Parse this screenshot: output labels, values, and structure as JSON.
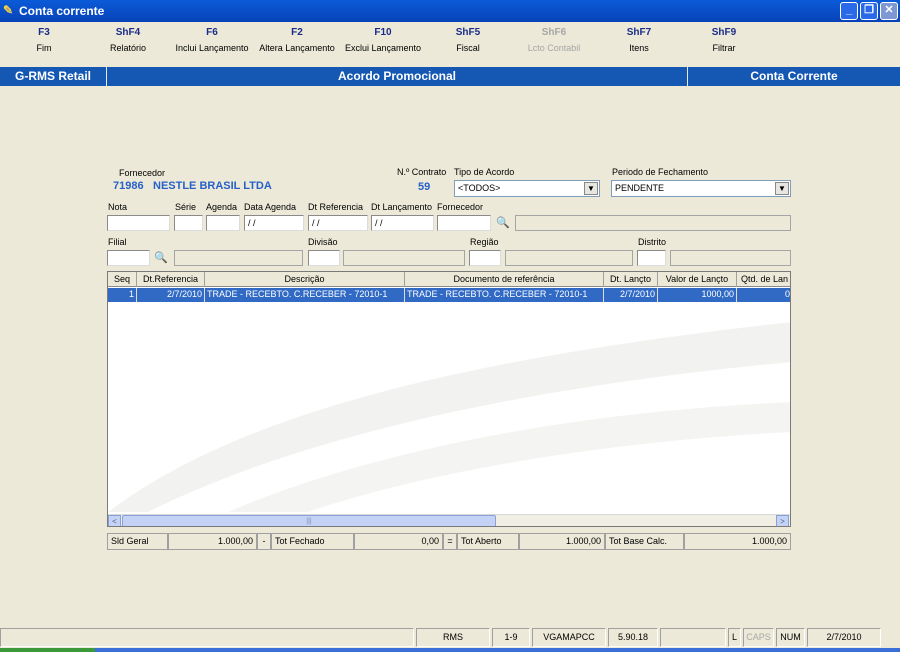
{
  "window": {
    "title": "Conta corrente",
    "app_icon": "app-icon",
    "controls": [
      "minimize-icon",
      "restore-icon",
      "close-icon"
    ]
  },
  "toolbar": [
    {
      "key": "F3",
      "label": "Fim",
      "enabled": true
    },
    {
      "key": "ShF4",
      "label": "Relatório",
      "enabled": true
    },
    {
      "key": "F6",
      "label": "Inclui Lançamento",
      "enabled": true
    },
    {
      "key": "F2",
      "label": "Altera Lançamento",
      "enabled": true
    },
    {
      "key": "F10",
      "label": "Exclui Lançamento",
      "enabled": true
    },
    {
      "key": "ShF5",
      "label": "Fiscal",
      "enabled": true
    },
    {
      "key": "ShF6",
      "label": "Lcto Contabil",
      "enabled": false
    },
    {
      "key": "ShF7",
      "label": "Itens",
      "enabled": true
    },
    {
      "key": "ShF9",
      "label": "Filtrar",
      "enabled": true
    }
  ],
  "band": {
    "left": "G-RMS Retail",
    "center": "Acordo Promocional",
    "right": "Conta Corrente"
  },
  "form": {
    "fornecedor_label": "Fornecedor",
    "fornecedor_code": "71986",
    "fornecedor_name": "NESTLE BRASIL LTDA",
    "contrato_label": "N.º Contrato",
    "contrato_value": "59",
    "tipo_acordo_label": "Tipo de Acordo",
    "tipo_acordo_value": "<TODOS>",
    "periodo_label": "Periodo de Fechamento",
    "periodo_value": "PENDENTE",
    "nota_label": "Nota",
    "serie_label": "Série",
    "agenda_label": "Agenda",
    "data_agenda_label": "Data Agenda",
    "data_agenda_value": "/ /",
    "dt_referencia_label": "Dt Referencia",
    "dt_referencia_value": "/ /",
    "dt_lancamento_label": "Dt Lançamento",
    "dt_lancamento_value": "/ /",
    "fornecedor2_label": "Fornecedor",
    "filial_label": "Filial",
    "divisao_label": "Divisão",
    "regiao_label": "Região",
    "distrito_label": "Distrito"
  },
  "grid": {
    "columns": [
      "Seq",
      "Dt.Referencia",
      "Descrição",
      "Documento de referência",
      "Dt. Lançto",
      "Valor de Lançto",
      "Qtd. de Lan"
    ],
    "rows": [
      {
        "seq": "1",
        "dt_referencia": "2/7/2010",
        "descricao": "TRADE - RECEBTO. C.RECEBER - 72010-1",
        "documento": "TRADE - RECEBTO. C.RECEBER - 72010-1",
        "dt_lancto": "2/7/2010",
        "valor": "1000,00",
        "qtd": "0"
      }
    ],
    "scroll_left": "<",
    "scroll_right": ">"
  },
  "totals": {
    "sld_geral_label": "Sld Geral",
    "sld_geral_value": "1.000,00",
    "minus": "-",
    "tot_fechado_label": "Tot Fechado",
    "tot_fechado_value": "0,00",
    "equals": "=",
    "tot_aberto_label": "Tot Aberto",
    "tot_aberto_value": "1.000,00",
    "tot_base_label": "Tot Base Calc.",
    "tot_base_value": "1.000,00"
  },
  "status": {
    "app": "RMS",
    "range": "1-9",
    "user": "VGAMAPCC",
    "version": "5.90.18",
    "l": "L",
    "caps": "CAPS",
    "num": "NUM",
    "date": "2/7/2010"
  },
  "colors": {
    "title_bar": "#0a5bd8",
    "band": "#1458b4",
    "selection": "#316ac5",
    "accent_text": "#2660c8"
  }
}
